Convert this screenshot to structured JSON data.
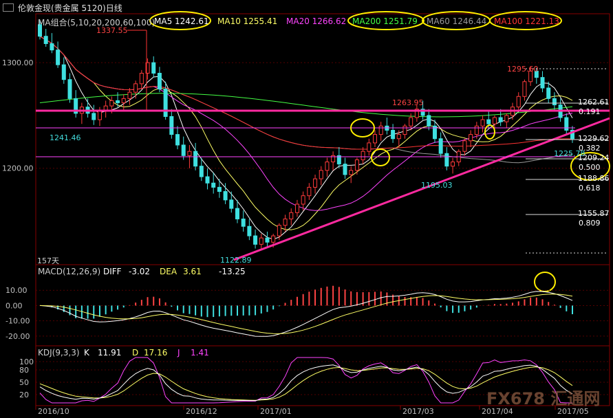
{
  "window": {
    "title": "伦敦金现(贵金属 5120)日线"
  },
  "ma_legend": {
    "label": "MA组合(5,10,20,200,60,100)",
    "items": [
      {
        "name": "MA5",
        "value": "1242.61",
        "color": "#ffffff",
        "highlight": true
      },
      {
        "name": "MA10",
        "value": "1255.41",
        "color": "#ffff66",
        "highlight": false
      },
      {
        "name": "MA20",
        "value": "1266.62",
        "color": "#ff44ff",
        "highlight": false
      },
      {
        "name": "MA200",
        "value": "1251.79",
        "color": "#44ff44",
        "highlight": true
      },
      {
        "name": "MA60",
        "value": "1246.44",
        "color": "#9a9a9a",
        "highlight": true
      },
      {
        "name": "MA100",
        "value": "1221.13",
        "color": "#ff3333",
        "highlight": true
      }
    ]
  },
  "price_labels": {
    "high_1337": "1337.55",
    "high_1295": "1295.60",
    "level_1263": "1263.95",
    "low_1241": "1241.46",
    "low_1195": "1195.03",
    "low_1122": "1122.89",
    "last_1225": "1225.78",
    "days": "157天"
  },
  "fib_levels": [
    {
      "price": "1262.61",
      "ratio": "0.191"
    },
    {
      "price": "1229.62",
      "ratio": "0.382"
    },
    {
      "price": "1209.24",
      "ratio": "0.500"
    },
    {
      "price": "1188.86",
      "ratio": "0.618"
    },
    {
      "price": "1155.87",
      "ratio": "0.809"
    }
  ],
  "macd_legend": {
    "label": "MACD(12,26,9)",
    "diff_label": "DIFF",
    "diff_value": "-3.02",
    "dea_label": "DEA",
    "dea_value": "3.61",
    "macd_value": "-13.25"
  },
  "kdj_legend": {
    "label": "KDJ(9,3,3)",
    "k_label": "K",
    "k_value": "11.91",
    "d_label": "D",
    "d_value": "17.16",
    "j_label": "J",
    "j_value": "1.41"
  },
  "watermark": "FX678 汇通网",
  "chart_data": {
    "type": "candlestick",
    "x_ticks": [
      "2016/10",
      "2016/12",
      "2017/01",
      "2017/03",
      "2017/04",
      "2017/05"
    ],
    "price_axis": {
      "ticks": [
        "1300.00",
        "1200.00"
      ],
      "range": [
        1110,
        1345
      ]
    },
    "macd_axis": {
      "ticks": [
        "10.00",
        "0.00",
        "-10.00",
        "-20.00"
      ],
      "range": [
        -25,
        20
      ]
    },
    "kdj_axis": {
      "ticks": [
        "100",
        "80",
        "50",
        "20"
      ],
      "range": [
        0,
        110
      ]
    },
    "candles": [
      [
        1336,
        1340,
        1322,
        1325
      ],
      [
        1325,
        1332,
        1315,
        1318
      ],
      [
        1318,
        1328,
        1309,
        1312
      ],
      [
        1312,
        1320,
        1295,
        1298
      ],
      [
        1298,
        1305,
        1280,
        1284
      ],
      [
        1284,
        1290,
        1262,
        1266
      ],
      [
        1266,
        1274,
        1248,
        1252
      ],
      [
        1252,
        1262,
        1242,
        1258
      ],
      [
        1258,
        1266,
        1248,
        1252
      ],
      [
        1252,
        1260,
        1241,
        1246
      ],
      [
        1246,
        1258,
        1240,
        1255
      ],
      [
        1255,
        1264,
        1248,
        1259
      ],
      [
        1259,
        1268,
        1252,
        1264
      ],
      [
        1264,
        1272,
        1258,
        1262
      ],
      [
        1262,
        1270,
        1254,
        1266
      ],
      [
        1266,
        1276,
        1260,
        1272
      ],
      [
        1272,
        1283,
        1266,
        1280
      ],
      [
        1280,
        1293,
        1275,
        1290
      ],
      [
        1290,
        1304,
        1284,
        1300
      ],
      [
        1300,
        1306,
        1286,
        1290
      ],
      [
        1290,
        1296,
        1272,
        1275
      ],
      [
        1275,
        1282,
        1246,
        1249
      ],
      [
        1249,
        1256,
        1228,
        1232
      ],
      [
        1232,
        1240,
        1218,
        1222
      ],
      [
        1222,
        1230,
        1208,
        1212
      ],
      [
        1212,
        1222,
        1200,
        1216
      ],
      [
        1216,
        1224,
        1198,
        1202
      ],
      [
        1202,
        1210,
        1188,
        1192
      ],
      [
        1192,
        1200,
        1180,
        1186
      ],
      [
        1186,
        1196,
        1176,
        1182
      ],
      [
        1182,
        1190,
        1172,
        1178
      ],
      [
        1178,
        1186,
        1166,
        1170
      ],
      [
        1170,
        1178,
        1158,
        1162
      ],
      [
        1162,
        1170,
        1148,
        1152
      ],
      [
        1152,
        1160,
        1140,
        1145
      ],
      [
        1145,
        1152,
        1132,
        1136
      ],
      [
        1136,
        1142,
        1124,
        1128
      ],
      [
        1128,
        1138,
        1123,
        1134
      ],
      [
        1134,
        1140,
        1126,
        1130
      ],
      [
        1130,
        1138,
        1125,
        1136
      ],
      [
        1136,
        1148,
        1132,
        1146
      ],
      [
        1146,
        1156,
        1140,
        1152
      ],
      [
        1152,
        1162,
        1146,
        1158
      ],
      [
        1158,
        1170,
        1154,
        1166
      ],
      [
        1166,
        1178,
        1160,
        1174
      ],
      [
        1174,
        1186,
        1170,
        1182
      ],
      [
        1182,
        1194,
        1176,
        1190
      ],
      [
        1190,
        1202,
        1184,
        1198
      ],
      [
        1198,
        1210,
        1192,
        1206
      ],
      [
        1206,
        1216,
        1198,
        1212
      ],
      [
        1212,
        1220,
        1200,
        1204
      ],
      [
        1204,
        1210,
        1190,
        1194
      ],
      [
        1194,
        1202,
        1186,
        1198
      ],
      [
        1198,
        1210,
        1194,
        1208
      ],
      [
        1208,
        1220,
        1204,
        1216
      ],
      [
        1216,
        1228,
        1212,
        1224
      ],
      [
        1224,
        1236,
        1220,
        1232
      ],
      [
        1232,
        1244,
        1226,
        1240
      ],
      [
        1240,
        1248,
        1232,
        1236
      ],
      [
        1236,
        1242,
        1224,
        1228
      ],
      [
        1228,
        1236,
        1220,
        1232
      ],
      [
        1232,
        1242,
        1228,
        1240
      ],
      [
        1240,
        1252,
        1236,
        1248
      ],
      [
        1248,
        1260,
        1244,
        1256
      ],
      [
        1256,
        1264,
        1246,
        1250
      ],
      [
        1250,
        1256,
        1236,
        1240
      ],
      [
        1240,
        1246,
        1224,
        1228
      ],
      [
        1228,
        1234,
        1210,
        1214
      ],
      [
        1214,
        1220,
        1198,
        1202
      ],
      [
        1202,
        1210,
        1195,
        1206
      ],
      [
        1206,
        1218,
        1202,
        1216
      ],
      [
        1216,
        1228,
        1212,
        1226
      ],
      [
        1226,
        1236,
        1220,
        1232
      ],
      [
        1232,
        1244,
        1228,
        1240
      ],
      [
        1240,
        1250,
        1234,
        1246
      ],
      [
        1246,
        1254,
        1238,
        1242
      ],
      [
        1242,
        1250,
        1236,
        1248
      ],
      [
        1248,
        1256,
        1240,
        1244
      ],
      [
        1244,
        1252,
        1238,
        1250
      ],
      [
        1250,
        1262,
        1246,
        1258
      ],
      [
        1258,
        1272,
        1254,
        1268
      ],
      [
        1268,
        1284,
        1264,
        1282
      ],
      [
        1282,
        1296,
        1278,
        1292
      ],
      [
        1292,
        1295,
        1280,
        1286
      ],
      [
        1286,
        1292,
        1272,
        1276
      ],
      [
        1276,
        1282,
        1262,
        1266
      ],
      [
        1266,
        1272,
        1254,
        1260
      ],
      [
        1260,
        1266,
        1244,
        1248
      ],
      [
        1248,
        1252,
        1232,
        1236
      ],
      [
        1236,
        1240,
        1224,
        1228
      ]
    ]
  }
}
